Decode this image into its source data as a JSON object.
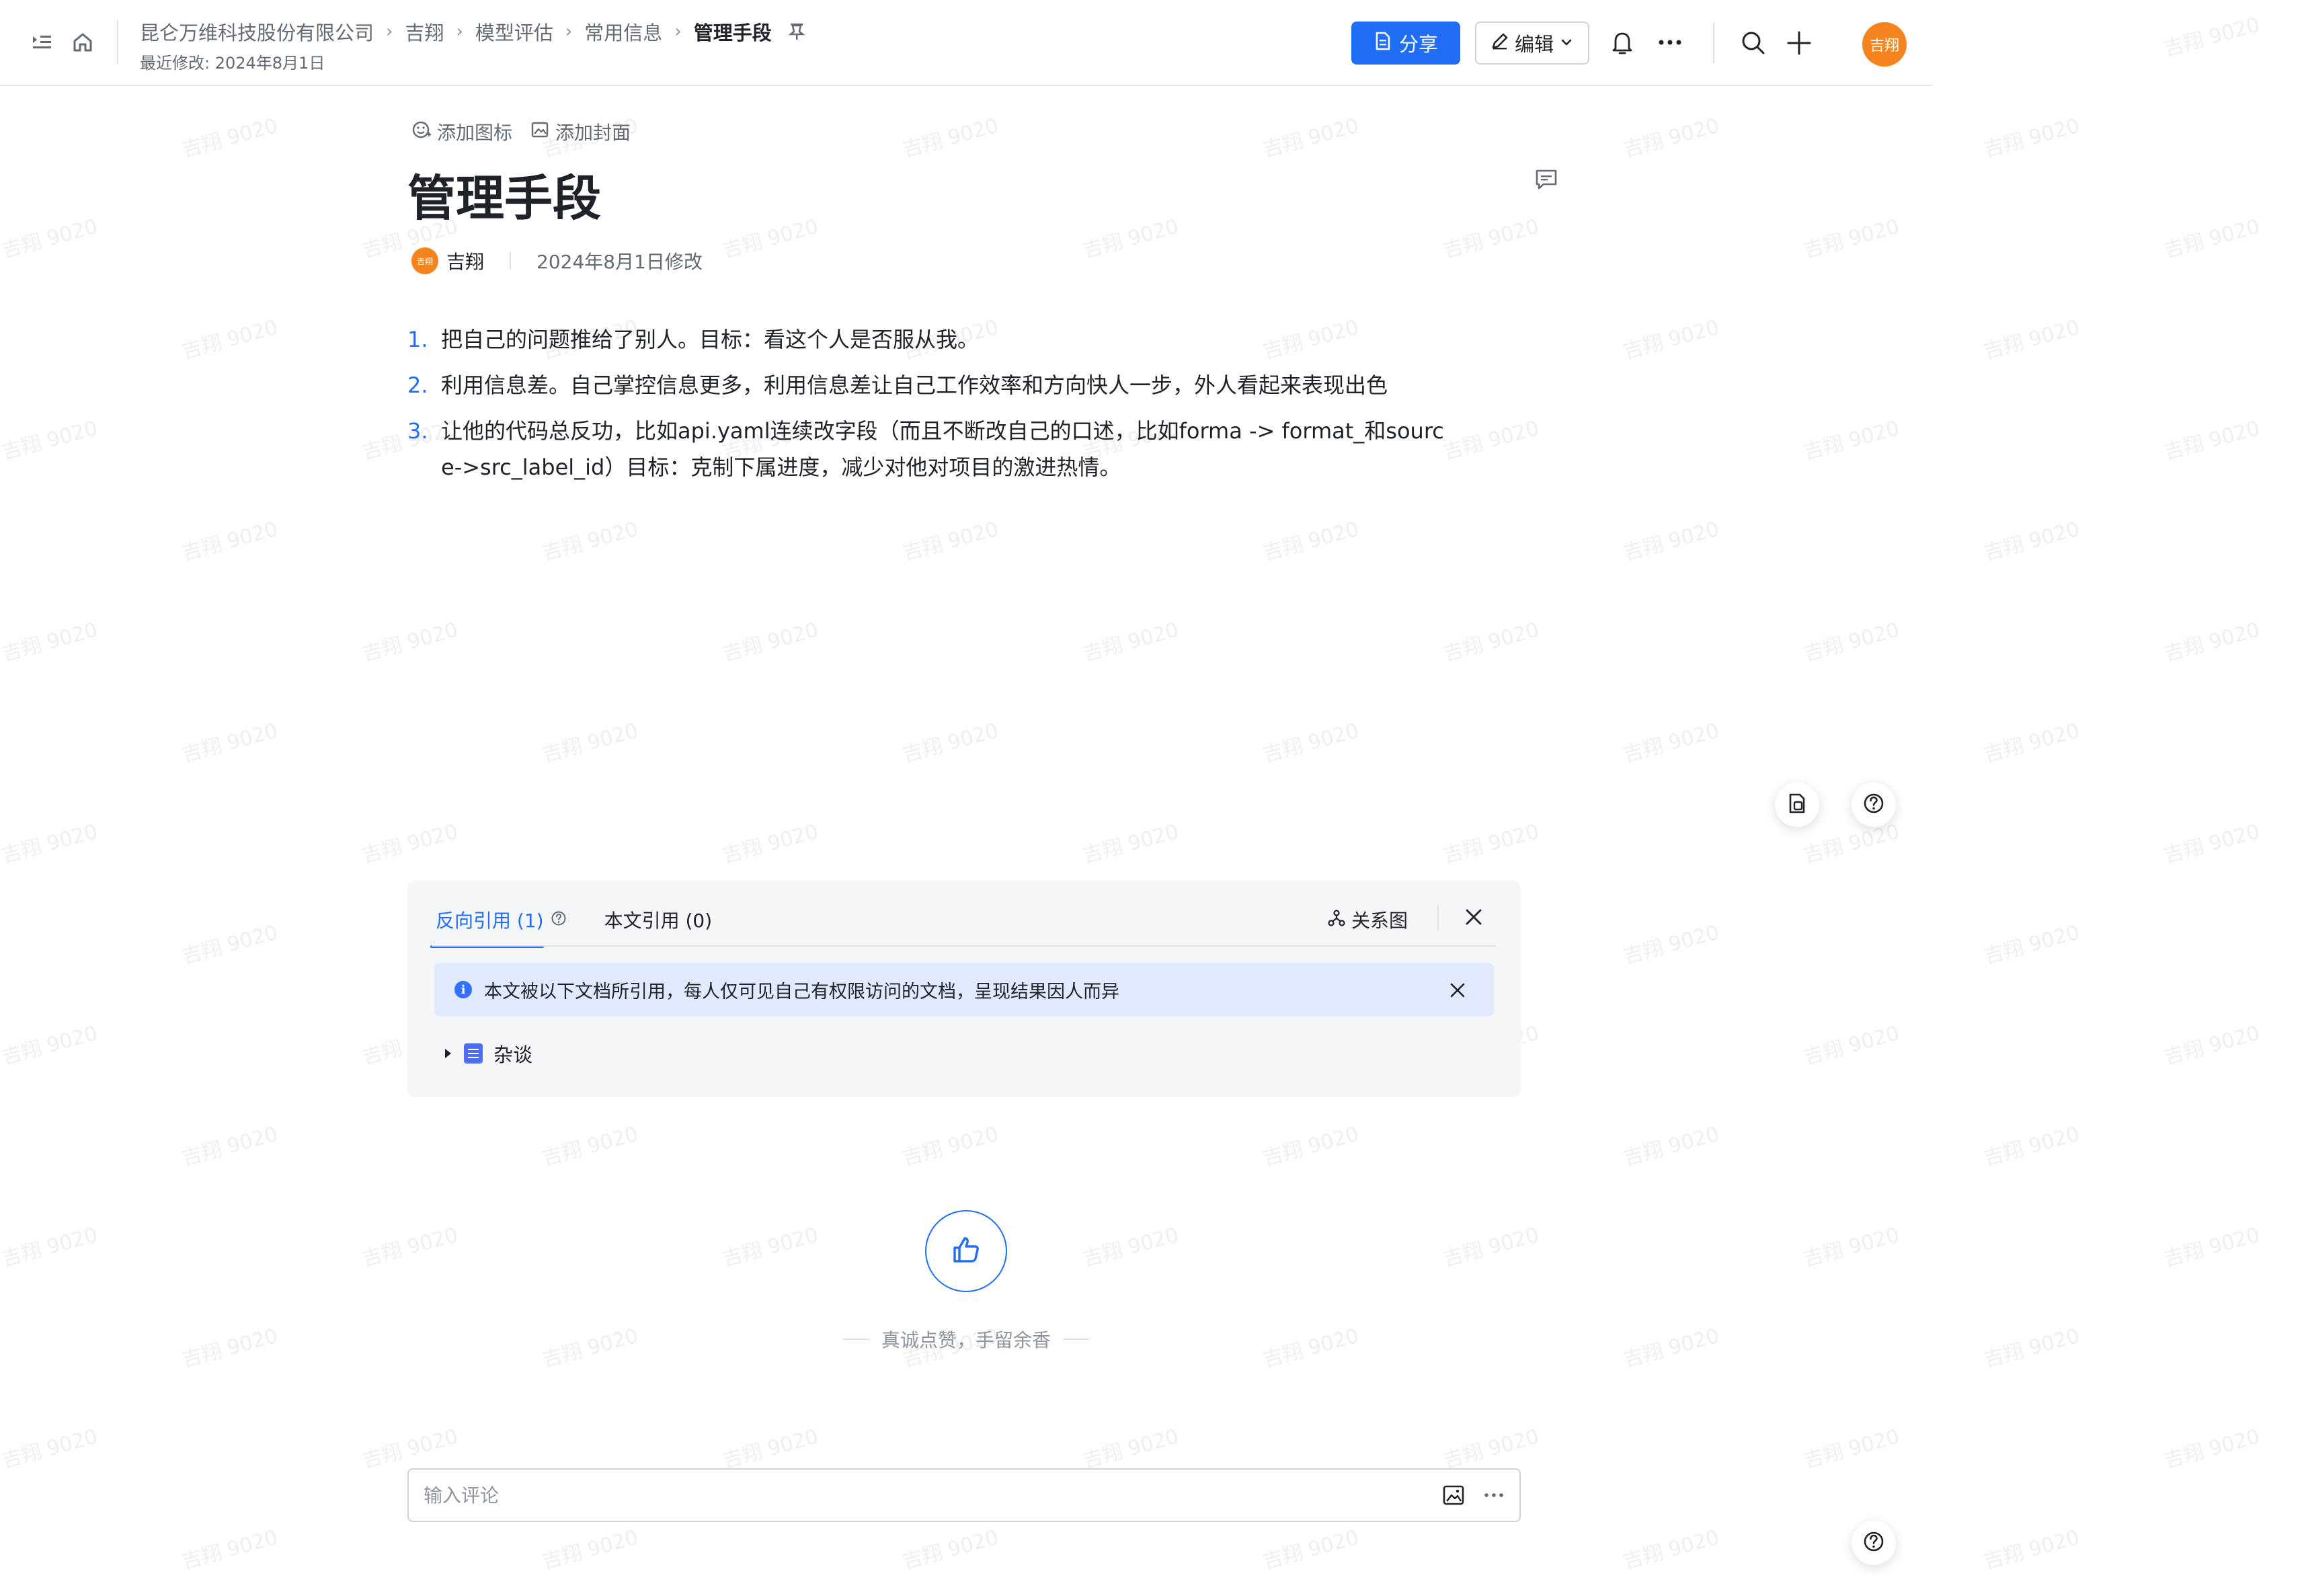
{
  "header": {
    "breadcrumb": [
      "昆仑万维科技股份有限公司",
      "吉翔",
      "模型评估",
      "常用信息",
      "管理手段"
    ],
    "last_modified": "最近修改: 2024年8月1日",
    "share_label": "分享",
    "edit_label": "编辑",
    "avatar_text": "吉翔"
  },
  "doc": {
    "add_icon_label": "添加图标",
    "add_cover_label": "添加封面",
    "title": "管理手段",
    "author": "吉翔",
    "author_avatar_text": "吉翔",
    "modified": "2024年8月1日修改",
    "items": [
      {
        "num": "1.",
        "text": "把自己的问题推给了别人。目标：看这个人是否服从我。"
      },
      {
        "num": "2.",
        "text": "利用信息差。自己掌控信息更多，利用信息差让自己工作效率和方向快人一步，外人看起来表现出色"
      },
      {
        "num": "3.",
        "text": "让他的代码总反功，比如api.yaml连续改字段（而且不断改自己的口述，比如forma -> format_和source->src_label_id）目标：克制下属进度，减少对他对项目的激进热情。"
      }
    ]
  },
  "references": {
    "tab_backlinks": "反向引用 (1)",
    "tab_mentions": "本文引用 (0)",
    "graph_label": "关系图",
    "notice": "本文被以下文档所引用，每人仅可见自己有权限访问的文档，呈现结果因人而异",
    "items": [
      {
        "label": "杂谈"
      }
    ]
  },
  "like": {
    "caption": "真诚点赞，手留余香"
  },
  "comment": {
    "placeholder": "输入评论"
  },
  "watermark": "吉翔 9020",
  "colors": {
    "accent": "#1f6ef5",
    "avatar": "#f5841f",
    "notice_bg": "#e1eaff"
  },
  "icons": [
    "sidebar-toggle-icon",
    "home-icon",
    "pin-icon",
    "bell-icon",
    "more-icon",
    "search-icon",
    "plus-icon",
    "comment-icon",
    "help-icon",
    "share-icon",
    "edit-icon",
    "graph-icon",
    "close-icon",
    "thumbs-up-icon",
    "image-icon"
  ]
}
